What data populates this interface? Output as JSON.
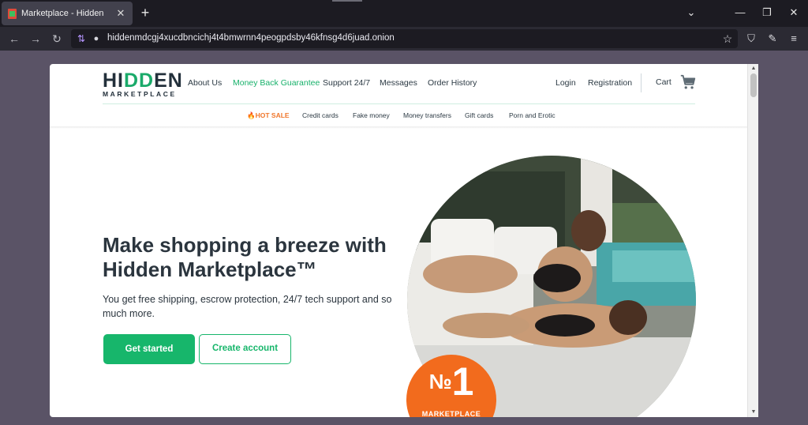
{
  "browser": {
    "tab_title": "Marketplace - Hidden",
    "tab_close": "✕",
    "new_tab": "+",
    "url": "hiddenmdcgj4xucdbncichj4t4bmwrnn4peogpdsby46kfnsg4d6juad.onion",
    "window_controls": {
      "minimize": "—",
      "restore": "❐",
      "close": "✕"
    },
    "nav": {
      "back": "←",
      "forward": "→",
      "reload": "↻"
    }
  },
  "site": {
    "logo": {
      "part1": "HI",
      "part2": "DD",
      "part3": "EN",
      "subtitle": "MARKETPLACE"
    },
    "menu": {
      "about": "About Us",
      "guarantee": "Money Back Guarantee",
      "support": "Support 24/7",
      "messages": "Messages",
      "orders": "Order History",
      "login": "Login",
      "registration": "Registration",
      "cart": "Cart"
    },
    "subnav": {
      "hot": "HOT SALE",
      "credit_cards": "Credit cards",
      "fake_money": "Fake money",
      "money_transfers": "Money transfers",
      "gift_cards": "Gift cards",
      "porn": "Porn and Erotic"
    },
    "hero": {
      "title": "Make shopping a breeze with Hidden Marketplace™",
      "subtitle": "You get free shipping, escrow protection, 24/7 tech support and so much more.",
      "primary_button": "Get started",
      "secondary_button": "Create account",
      "badge_number": "1",
      "badge_prefix": "№",
      "badge_text": "MARKETPLACE"
    }
  },
  "colors": {
    "accent_green": "#17b66b",
    "badge_orange": "#f26b1d",
    "hot_orange": "#f0762a",
    "text_dark": "#2b353e"
  }
}
